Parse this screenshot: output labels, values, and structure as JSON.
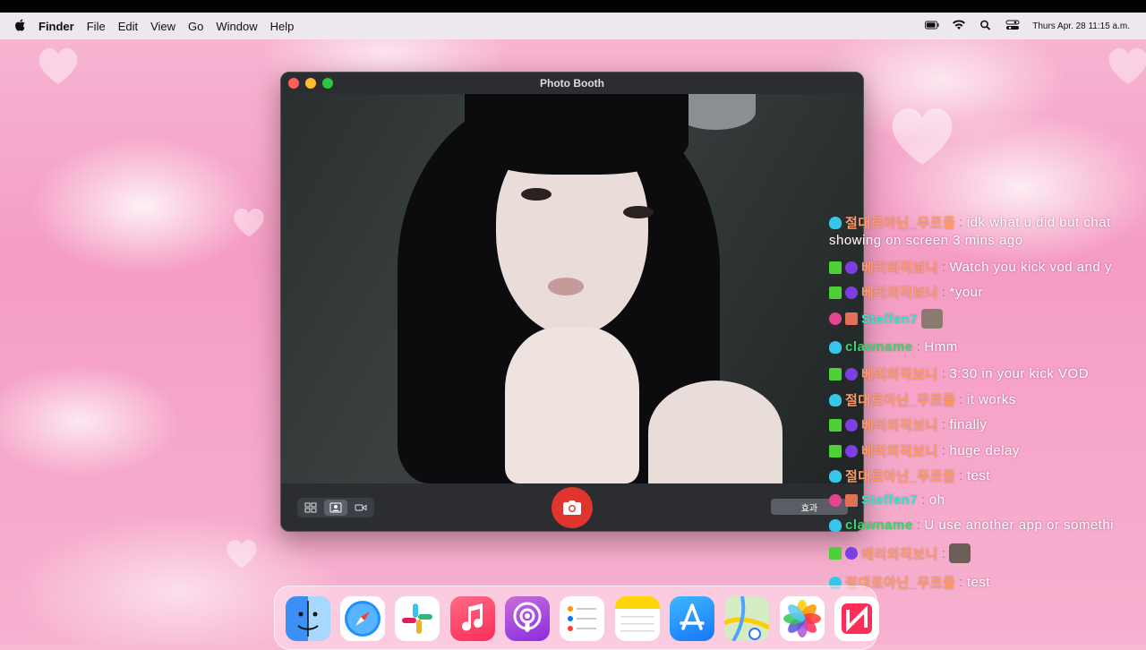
{
  "menubar": {
    "app_name": "Finder",
    "menus": [
      "Edit",
      "View",
      "Go",
      "Window",
      "Help"
    ],
    "menu_file": "File",
    "datetime": "Thurs Apr. 28 11:15 a.m.",
    "icons": [
      "battery-icon",
      "wifi-icon",
      "spotlight-search-icon",
      "control-center-icon"
    ]
  },
  "window": {
    "title": "Photo Booth",
    "effects_label": "효과",
    "traffic_light_colors": {
      "close": "#ff5f57",
      "minimize": "#febc2e",
      "zoom": "#28c840"
    },
    "mode_icons": [
      "grid-four-up-icon",
      "single-photo-icon",
      "video-icon"
    ],
    "active_mode_index": 1,
    "shutter_color": "#e0342f"
  },
  "chat": {
    "messages": [
      {
        "user": "절대로아닌_무르졸",
        "user_color": "#ff9a62",
        "text": "idk what u did but chat",
        "continued": "showing on screen 3 mins ago",
        "badges": [
          "gem-icon"
        ]
      },
      {
        "user": "베리의직보니",
        "user_color": "#ff9a62",
        "text": "Watch you kick vod and y",
        "badges": [
          "mod-sword-icon",
          "purple-gem-icon"
        ]
      },
      {
        "user": "베리의직보니",
        "user_color": "#ff9a62",
        "text": "*your",
        "badges": [
          "mod-sword-icon",
          "purple-gem-icon"
        ]
      },
      {
        "user": "Steffen7",
        "user_color": "#2ee6c9",
        "text": "",
        "emote": "handshake-emote",
        "badges": [
          "pink-gem-icon",
          "gift-icon"
        ]
      },
      {
        "user": "clawname",
        "user_color": "#3bd46b",
        "text": "Hmm",
        "badges": [
          "gem-icon"
        ]
      },
      {
        "user": "베리의직보니",
        "user_color": "#ff9a62",
        "text": "3:30 in your kick VOD",
        "badges": [
          "mod-sword-icon",
          "purple-gem-icon"
        ]
      },
      {
        "user": "절대로아닌_무르졸",
        "user_color": "#ff9a62",
        "text": "it works",
        "badges": [
          "gem-icon"
        ]
      },
      {
        "user": "베리의직보니",
        "user_color": "#ff9a62",
        "text": "finally",
        "badges": [
          "mod-sword-icon",
          "purple-gem-icon"
        ]
      },
      {
        "user": "베리의직보니",
        "user_color": "#ff9a62",
        "text": "huge delay",
        "badges": [
          "mod-sword-icon",
          "purple-gem-icon"
        ]
      },
      {
        "user": "절대로아닌_무르졸",
        "user_color": "#ff9a62",
        "text": "test",
        "badges": [
          "gem-icon"
        ]
      },
      {
        "user": "Steffen7",
        "user_color": "#2ee6c9",
        "text": "oh",
        "badges": [
          "pink-gem-icon",
          "gift-icon"
        ]
      },
      {
        "user": "clawname",
        "user_color": "#3bd46b",
        "text": "U use another app or somethi",
        "badges": [
          "gem-icon"
        ]
      },
      {
        "user": "베리의직보니",
        "user_color": "#ff9a62",
        "text": "",
        "emote": "face-emote",
        "badges": [
          "mod-sword-icon",
          "purple-gem-icon"
        ]
      },
      {
        "user": "절대로아닌_무르졸",
        "user_color": "#ff9a62",
        "text": "test",
        "badges": [
          "gem-icon"
        ]
      }
    ]
  },
  "dock": {
    "apps": [
      "finder-icon",
      "safari-icon",
      "slack-icon",
      "music-icon",
      "podcasts-icon",
      "reminders-icon",
      "notes-icon",
      "app-store-icon",
      "maps-icon",
      "photos-icon",
      "news-icon"
    ]
  }
}
